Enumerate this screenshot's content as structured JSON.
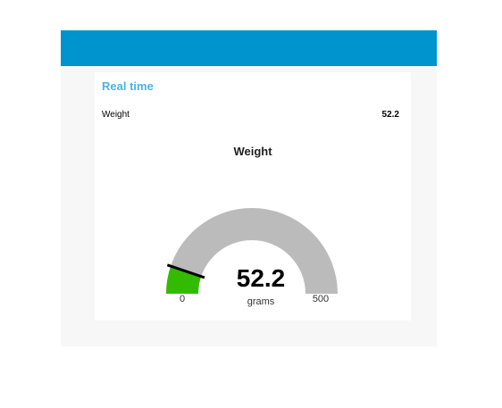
{
  "group": {
    "title": "Real time"
  },
  "text_widget": {
    "label": "Weight",
    "value": "52.2"
  },
  "gauge": {
    "title": "Weight",
    "value": 52.2,
    "value_text": "52.2",
    "units": "grams",
    "min": 0,
    "max": 500,
    "min_label": "0",
    "max_label": "500",
    "fill_color": "#33bb00",
    "track_color": "#bbbbbb",
    "needle_color": "#000000"
  },
  "colors": {
    "header": "#0094ce",
    "group_title": "#4bb2e6",
    "background": "#f7f7f7",
    "card": "#ffffff"
  }
}
